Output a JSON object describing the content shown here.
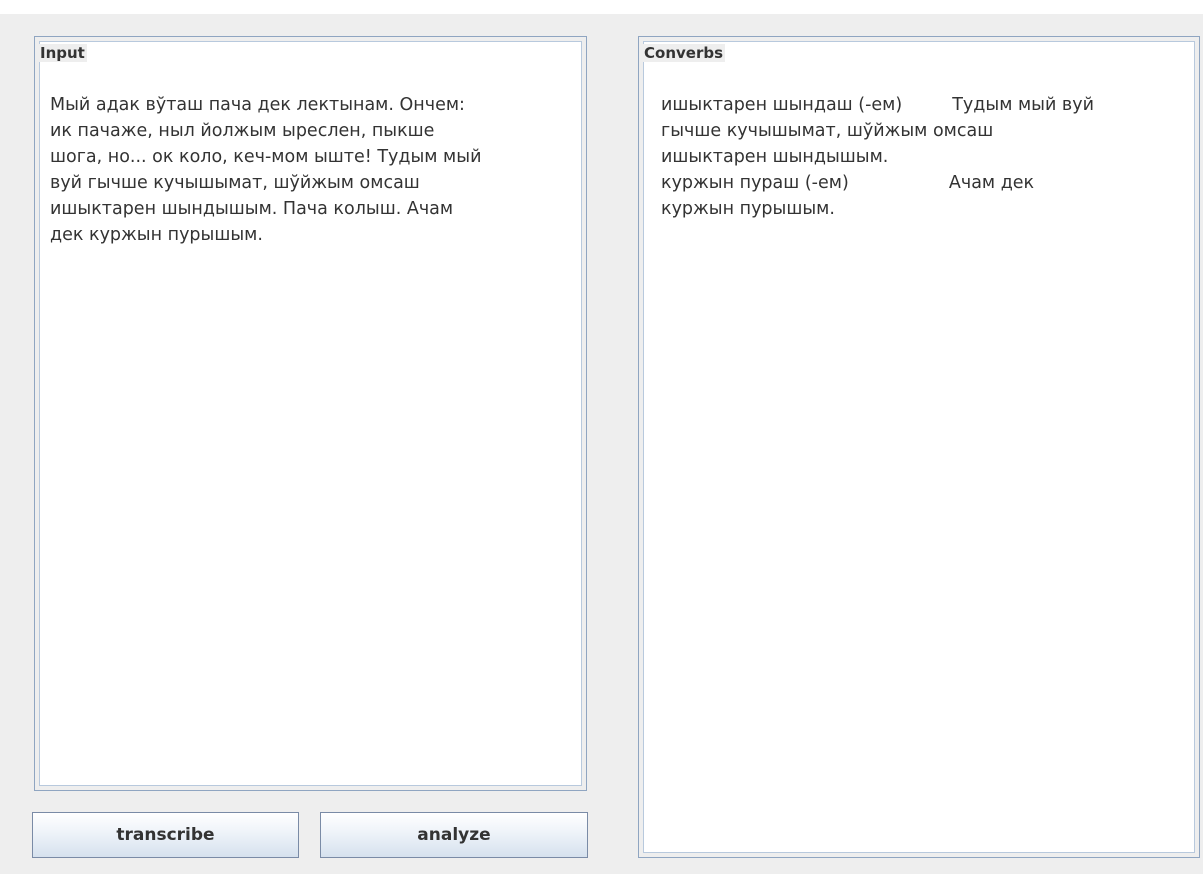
{
  "input": {
    "legend": "Input",
    "text": "Мый адак вўташ пача дек лектынам. Ончем:\nик пачаже, ныл йолжым ыреслен, пыкше\nшога, но... ок коло, кеч-мом ыште! Тудым мый\nвуй гычше кучышымат, шўйжым омсаш\nишыктарен шындышым. Пача колыш. Ачам\nдек куржын пурышым."
  },
  "output": {
    "legend": "Converbs",
    "text": "ишыктарен шындаш (-ем)         Тудым мый вуй\nгычше кучышымат, шўйжым омсаш\nишыктарен шындышым.\nкуржын пураш (-ем)                  Ачам дек\nкуржын пурышым."
  },
  "buttons": {
    "transcribe": "transcribe",
    "analyze": "analyze"
  }
}
